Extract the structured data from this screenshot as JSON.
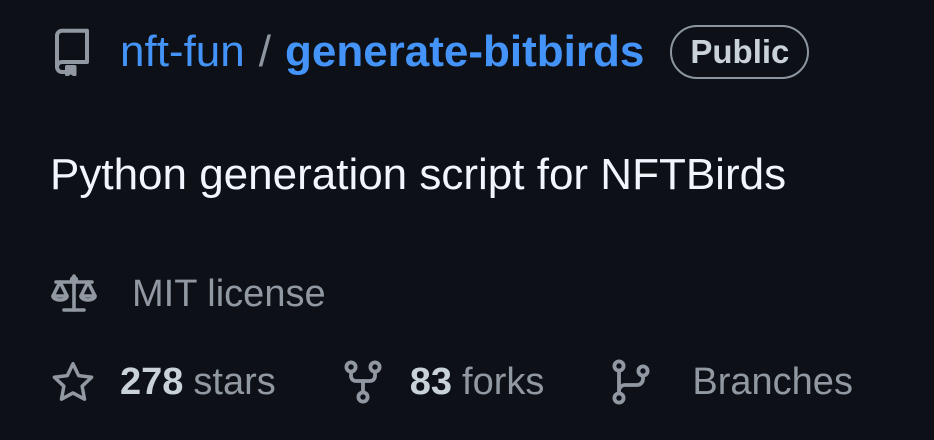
{
  "repo": {
    "owner": "nft-fun",
    "separator": "/",
    "name": "generate-bitbirds",
    "visibility": "Public",
    "description": "Python generation script for NFTBirds",
    "license": "MIT license"
  },
  "stats": {
    "stars_count": "278",
    "stars_label": "stars",
    "forks_count": "83",
    "forks_label": "forks",
    "branches_label": "Branches"
  },
  "icons": {
    "repo": "repo-icon",
    "license": "law-scale-icon",
    "stars": "star-icon",
    "forks": "fork-icon",
    "branches": "branch-icon"
  },
  "colors": {
    "background": "#0d1117",
    "link": "#4493f8",
    "muted": "#9198a1",
    "text": "#f0f6fc"
  }
}
